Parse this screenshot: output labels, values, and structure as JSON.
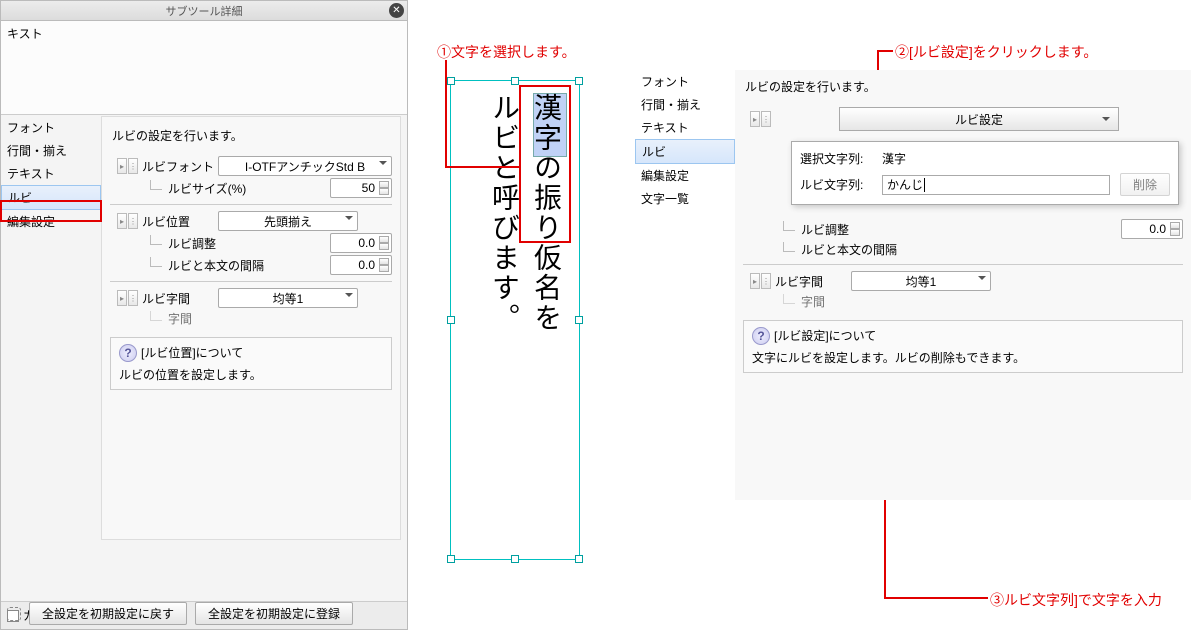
{
  "left_panel": {
    "title": "サブツール詳細",
    "tab": "キスト",
    "sidebar": {
      "font": "フォント",
      "align": "行間・揃え",
      "text": "テキスト",
      "ruby": "ルビ",
      "edit": "編集設定"
    },
    "desc": "ルビの設定を行います。",
    "rows": {
      "ruby_font_label": "ルビフォント",
      "ruby_font_value": "I-OTFアンチックStd B",
      "ruby_size_label": "ルビサイズ(%)",
      "ruby_size_value": "50",
      "ruby_pos_label": "ルビ位置",
      "ruby_pos_value": "先頭揃え",
      "ruby_adjust_label": "ルビ調整",
      "ruby_adjust_value": "0.0",
      "ruby_gap_label": "ルビと本文の間隔",
      "ruby_gap_value": "0.0",
      "ruby_spacing_label": "ルビ字間",
      "ruby_spacing_value": "均等1",
      "char_spacing_label": "字間"
    },
    "help": {
      "title": "[ルビ位置]について",
      "body": "ルビの位置を設定します。"
    },
    "footer": {
      "category": "カテゴリ表示",
      "reset": "全設定を初期設定に戻す",
      "register": "全設定を初期設定に登録"
    }
  },
  "center": {
    "line1": "漢字の振り仮名を",
    "line2": "ルビと呼びます。"
  },
  "annotations": {
    "a1": "①文字を選択します。",
    "a2": "②[ルビ設定]をクリックします。",
    "a3": "③ルビ文字列]で文字を入力"
  },
  "right_panel": {
    "sidebar": {
      "font": "フォント",
      "align": "行間・揃え",
      "text": "テキスト",
      "ruby": "ルビ",
      "edit": "編集設定",
      "list": "文字一覧"
    },
    "desc": "ルビの設定を行います。",
    "ruby_settings_btn": "ルビ設定",
    "selected_label": "選択文字列:",
    "selected_value": "漢字",
    "ruby_string_label": "ルビ文字列:",
    "ruby_string_value": "かんじ",
    "delete": "削除",
    "ruby_adjust_label": "ルビ調整",
    "ruby_adjust_value2": "0.0",
    "ruby_gap_label": "ルビと本文の間隔",
    "ruby_spacing_label": "ルビ字間",
    "ruby_spacing_value": "均等1",
    "char_spacing_label": "字間",
    "help_title": "[ルビ設定]について",
    "help_body": "文字にルビを設定します。ルビの削除もできます。"
  }
}
